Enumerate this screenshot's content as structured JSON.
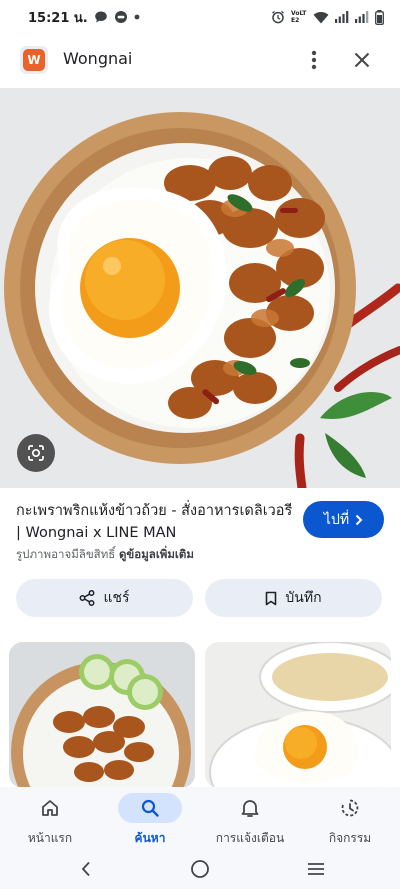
{
  "status_bar": {
    "time": "15:21 น.",
    "network_label": "VoLTE2"
  },
  "app_bar": {
    "logo_letter": "W",
    "title": "Wongnai",
    "more_icon": "more-vert-icon",
    "close_icon": "close-icon"
  },
  "result": {
    "title": "กะเพราพริกแห้งข้าวถ้วย - สั่งอาหารเดลิเวอรี | Wongnai x LINE MAN",
    "subtitle_prefix": "รูปภาพอาจมีลิขสิทธิ์",
    "subtitle_link": "ดูข้อมูลเพิ่มเติม",
    "visit_label": "ไปที่",
    "share_label": "แชร์",
    "save_label": "บันทึก"
  },
  "bottom_nav": [
    {
      "label": "หน้าแรก",
      "icon": "home-icon"
    },
    {
      "label": "ค้นหา",
      "icon": "search-icon"
    },
    {
      "label": "การแจ้งเตือน",
      "icon": "bell-icon"
    },
    {
      "label": "กิจกรรม",
      "icon": "activity-icon"
    }
  ],
  "colors": {
    "accent": "#0b57d0",
    "active_pill": "#d3e3fd",
    "chip_bg": "#e9eef6",
    "logo_orange": "#e8622a"
  }
}
